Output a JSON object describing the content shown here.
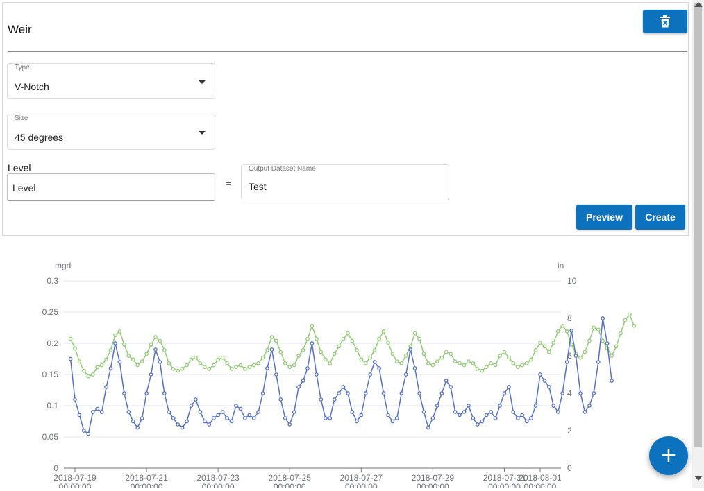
{
  "panel": {
    "title": "Weir",
    "type": {
      "label": "Type",
      "value": "V-Notch"
    },
    "size": {
      "label": "Size",
      "value": "45 degrees"
    },
    "level": {
      "label": "Level",
      "value": "Level"
    },
    "equals": "=",
    "output": {
      "label": "Output Dataset Name",
      "value": "Test"
    },
    "preview_label": "Preview",
    "create_label": "Create",
    "delete_icon": "trash-x-icon"
  },
  "fab": {
    "label": "+",
    "icon": "plus-icon"
  },
  "colors": {
    "accent": "#0d72bd",
    "series_flow": "#5470c6",
    "series_level": "#91cc75"
  },
  "chart_data": {
    "type": "line",
    "y_left_unit": "mgd",
    "y_right_unit": "in",
    "y_left_ticks": [
      "0",
      "0.05",
      "0.1",
      "0.15",
      "0.2",
      "0.25",
      "0.3"
    ],
    "y_right_ticks": [
      "0",
      "2",
      "4",
      "6",
      "8",
      "10"
    ],
    "ylim_left": [
      0,
      0.3
    ],
    "ylim_right": [
      0,
      10
    ],
    "x_ticks": [
      "2018-07-19 00:00:00",
      "2018-07-21 00:00:00",
      "2018-07-23 00:00:00",
      "2018-07-25 00:00:00",
      "2018-07-27 00:00:00",
      "2018-07-29 00:00:00",
      "2018-07-31 00:00:00",
      "2018-08-01 00:00:00"
    ],
    "x_range": [
      "2018-07-19",
      "2018-08-01"
    ],
    "grid": true,
    "series": [
      {
        "axis": "left",
        "color": "#5470c6",
        "x_start": "2018-07-18 21:00",
        "step_hours": 3,
        "values": [
          0.175,
          0.11,
          0.085,
          0.06,
          0.055,
          0.09,
          0.095,
          0.09,
          0.13,
          0.16,
          0.2,
          0.17,
          0.12,
          0.09,
          0.075,
          0.065,
          0.08,
          0.12,
          0.15,
          0.19,
          0.17,
          0.12,
          0.09,
          0.08,
          0.07,
          0.065,
          0.075,
          0.1,
          0.11,
          0.09,
          0.075,
          0.07,
          0.08,
          0.085,
          0.09,
          0.08,
          0.075,
          0.1,
          0.095,
          0.08,
          0.085,
          0.08,
          0.09,
          0.12,
          0.16,
          0.19,
          0.15,
          0.11,
          0.08,
          0.07,
          0.09,
          0.13,
          0.14,
          0.16,
          0.2,
          0.15,
          0.11,
          0.08,
          0.08,
          0.11,
          0.12,
          0.13,
          0.12,
          0.09,
          0.075,
          0.085,
          0.12,
          0.15,
          0.17,
          0.16,
          0.12,
          0.085,
          0.075,
          0.08,
          0.12,
          0.15,
          0.19,
          0.16,
          0.12,
          0.09,
          0.065,
          0.08,
          0.1,
          0.12,
          0.14,
          0.13,
          0.09,
          0.085,
          0.09,
          0.1,
          0.08,
          0.07,
          0.075,
          0.085,
          0.09,
          0.08,
          0.1,
          0.12,
          0.13,
          0.09,
          0.08,
          0.085,
          0.075,
          0.08,
          0.1,
          0.15,
          0.14,
          0.13,
          0.1,
          0.09,
          0.12,
          0.17,
          0.22,
          0.18,
          0.12,
          0.09,
          0.1,
          0.12,
          0.17,
          0.24,
          0.2,
          0.14
        ]
      },
      {
        "axis": "right",
        "color": "#91cc75",
        "x_start": "2018-07-18 21:00",
        "step_hours": 3,
        "values": [
          6.9,
          6.4,
          5.7,
          5.2,
          4.9,
          5.0,
          5.4,
          5.5,
          5.8,
          6.3,
          7.1,
          7.3,
          6.6,
          6.0,
          5.8,
          5.5,
          5.7,
          6.1,
          6.6,
          7.0,
          6.8,
          6.3,
          5.6,
          5.3,
          5.2,
          5.3,
          5.5,
          5.8,
          5.9,
          5.6,
          5.4,
          5.3,
          5.5,
          5.8,
          5.9,
          5.6,
          5.3,
          5.4,
          5.5,
          5.3,
          5.4,
          5.5,
          5.6,
          5.9,
          6.3,
          7.0,
          6.8,
          6.2,
          5.6,
          5.4,
          5.5,
          6.0,
          6.3,
          6.9,
          7.6,
          6.9,
          6.2,
          5.8,
          5.6,
          6.1,
          6.5,
          6.9,
          7.2,
          6.8,
          6.3,
          5.8,
          5.6,
          5.9,
          6.3,
          6.9,
          7.3,
          6.7,
          6.1,
          5.7,
          5.6,
          6.0,
          6.5,
          7.2,
          6.9,
          6.1,
          5.6,
          5.5,
          5.7,
          5.9,
          6.2,
          6.1,
          5.7,
          5.6,
          5.5,
          5.7,
          5.6,
          5.3,
          5.2,
          5.4,
          5.6,
          5.5,
          6.0,
          6.2,
          5.9,
          5.6,
          5.4,
          5.5,
          5.6,
          5.8,
          6.3,
          6.7,
          6.5,
          6.2,
          6.7,
          7.3,
          7.6,
          7.3,
          6.6,
          6.1,
          5.9,
          6.2,
          6.8,
          7.5,
          7.4,
          6.8,
          6.4,
          6.0,
          6.5,
          7.2,
          7.9,
          8.2,
          7.6
        ]
      }
    ]
  }
}
